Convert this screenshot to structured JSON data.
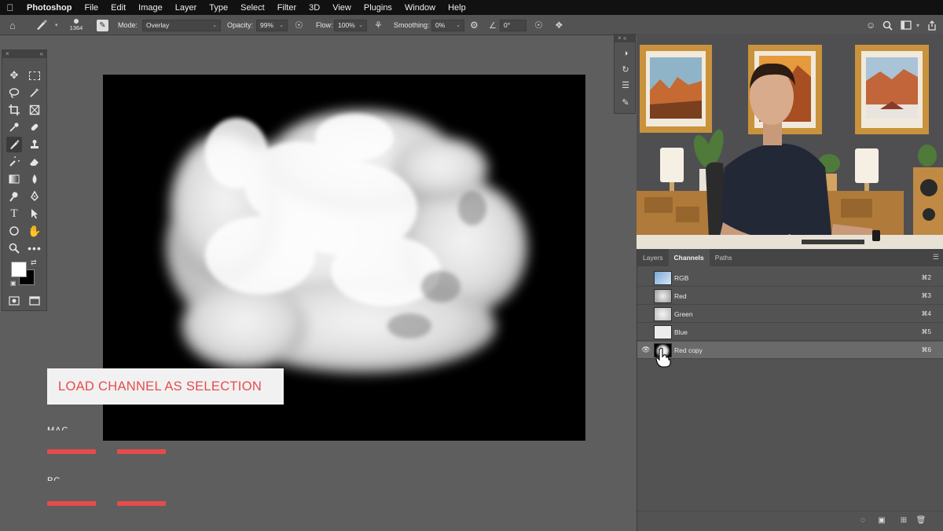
{
  "menubar": {
    "items": [
      "Photoshop",
      "File",
      "Edit",
      "Image",
      "Layer",
      "Type",
      "Select",
      "Filter",
      "3D",
      "View",
      "Plugins",
      "Window",
      "Help"
    ]
  },
  "options": {
    "brush_size": "1364",
    "mode_label": "Mode:",
    "mode_value": "Overlay",
    "opacity_label": "Opacity:",
    "opacity_value": "99%",
    "flow_label": "Flow:",
    "flow_value": "100%",
    "smoothing_label": "Smoothing:",
    "smoothing_value": "0%",
    "angle_value": "0°"
  },
  "tools": {
    "active": "brush-tool",
    "foreground_color": "#ffffff",
    "background_color": "#000000"
  },
  "overlay": {
    "title": "LOAD CHANNEL AS SELECTION",
    "mac_label": "MAC",
    "pc_label": "PC",
    "accent": "#e64b4b"
  },
  "channels_panel": {
    "tabs": [
      "Layers",
      "Channels",
      "Paths"
    ],
    "active_tab": "Channels",
    "channels": [
      {
        "name": "RGB",
        "shortcut": "⌘2",
        "visible": false,
        "selected": false
      },
      {
        "name": "Red",
        "shortcut": "⌘3",
        "visible": false,
        "selected": false
      },
      {
        "name": "Green",
        "shortcut": "⌘4",
        "visible": false,
        "selected": false
      },
      {
        "name": "Blue",
        "shortcut": "⌘5",
        "visible": false,
        "selected": false
      },
      {
        "name": "Red copy",
        "shortcut": "⌘6",
        "visible": true,
        "selected": true
      }
    ]
  }
}
